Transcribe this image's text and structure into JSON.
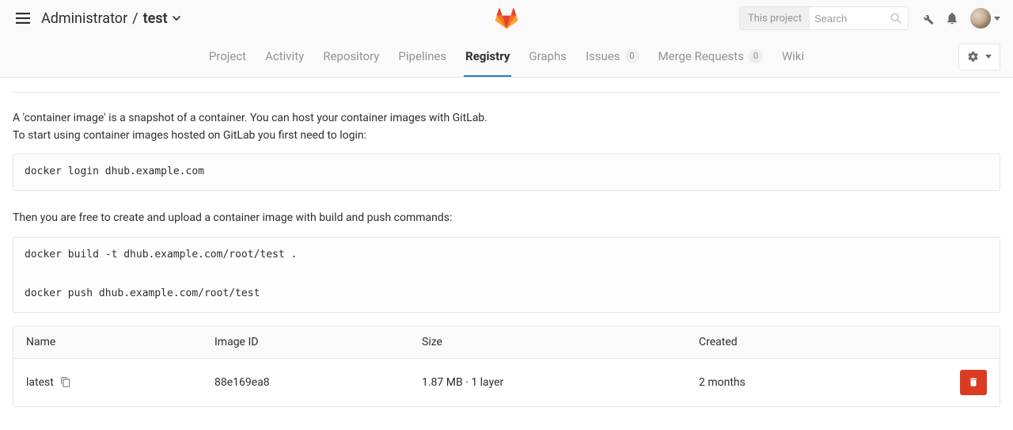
{
  "header": {
    "breadcrumb_owner": "Administrator",
    "breadcrumb_slash": "/",
    "breadcrumb_project": "test",
    "search_scope": "This project",
    "search_placeholder": "Search"
  },
  "tabs": {
    "project": "Project",
    "activity": "Activity",
    "repository": "Repository",
    "pipelines": "Pipelines",
    "registry": "Registry",
    "graphs": "Graphs",
    "issues": "Issues",
    "issues_count": "0",
    "merge_requests": "Merge Requests",
    "merge_requests_count": "0",
    "wiki": "Wiki"
  },
  "intro": {
    "p1": "A 'container image' is a snapshot of a container. You can host your container images with GitLab.",
    "p2": "To start using container images hosted on GitLab you first need to login:",
    "code1": "docker login dhub.example.com",
    "p3": "Then you are free to create and upload a container image with build and push commands:",
    "code2": "docker build -t dhub.example.com/root/test .\n\ndocker push dhub.example.com/root/test"
  },
  "table": {
    "headers": {
      "name": "Name",
      "image_id": "Image ID",
      "size": "Size",
      "created": "Created"
    },
    "rows": [
      {
        "name": "latest",
        "image_id": "88e169ea8",
        "size": "1.87 MB · 1 layer",
        "created": "2 months"
      }
    ]
  }
}
